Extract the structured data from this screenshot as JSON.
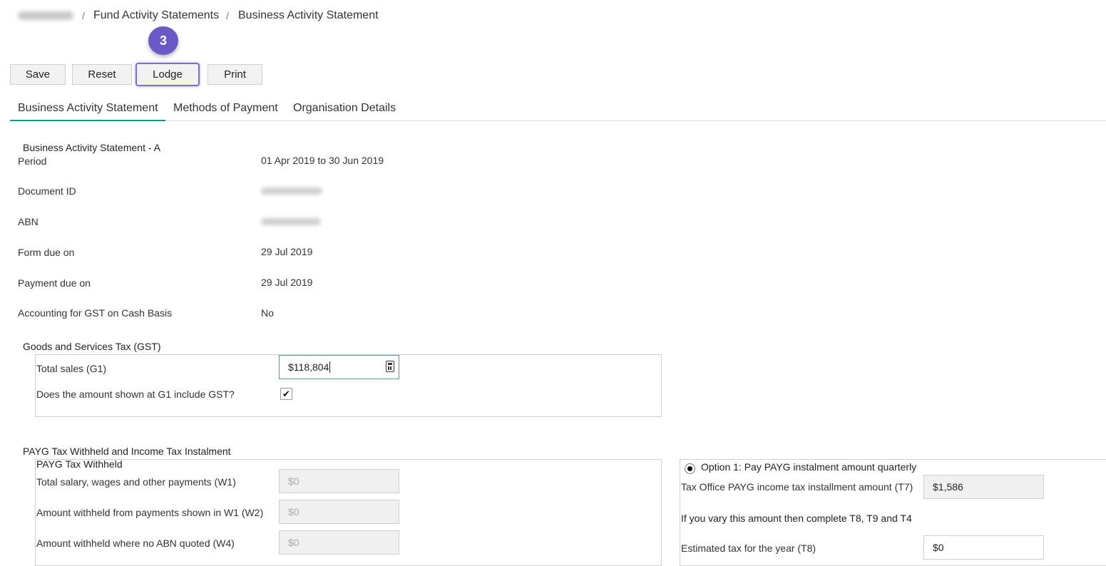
{
  "breadcrumb": {
    "items": [
      "Fund Activity Statements",
      "Business Activity Statement"
    ],
    "separator": "/"
  },
  "step_badge": "3",
  "toolbar": {
    "save": "Save",
    "reset": "Reset",
    "lodge": "Lodge",
    "print": "Print"
  },
  "tabs": [
    {
      "label": "Business Activity Statement",
      "active": true
    },
    {
      "label": "Methods of Payment",
      "active": false
    },
    {
      "label": "Organisation Details",
      "active": false
    }
  ],
  "statement": {
    "heading": "Business Activity Statement - A",
    "rows": [
      {
        "label": "Period",
        "value": "01 Apr 2019 to 30 Jun 2019"
      },
      {
        "label": "Document ID",
        "value": ""
      },
      {
        "label": "ABN",
        "value": ""
      },
      {
        "label": "Form due on",
        "value": "29 Jul 2019"
      },
      {
        "label": "Payment due on",
        "value": "29 Jul 2019"
      },
      {
        "label": "Accounting for GST on Cash Basis",
        "value": "No"
      }
    ]
  },
  "gst": {
    "heading": "Goods and Services Tax (GST)",
    "total_sales_label": "Total sales (G1)",
    "total_sales_value": "$118,804",
    "includes_gst_label": "Does the amount shown at G1 include GST?",
    "includes_gst_checked": true
  },
  "payg": {
    "heading": "PAYG Tax Withheld and Income Tax Instalment",
    "withheld_heading": "PAYG Tax Withheld",
    "rows": [
      {
        "label": "Total salary, wages and other payments (W1)",
        "value": "$0"
      },
      {
        "label": "Amount withheld from payments shown in W1 (W2)",
        "value": "$0"
      },
      {
        "label": "Amount withheld where no ABN quoted (W4)",
        "value": "$0"
      }
    ],
    "option1_label": "Option 1: Pay PAYG instalment amount quarterly",
    "option1_selected": true,
    "t7_label": "Tax Office PAYG income tax installment amount (T7)",
    "t7_value": "$1,586",
    "vary_note": "If you vary this amount then complete T8, T9 and T4",
    "t8_label": "Estimated tax for the year (T8)",
    "t8_value": "$0"
  },
  "colors": {
    "accent_teal": "#1a8f8a",
    "badge_purple": "#6a59c7"
  }
}
